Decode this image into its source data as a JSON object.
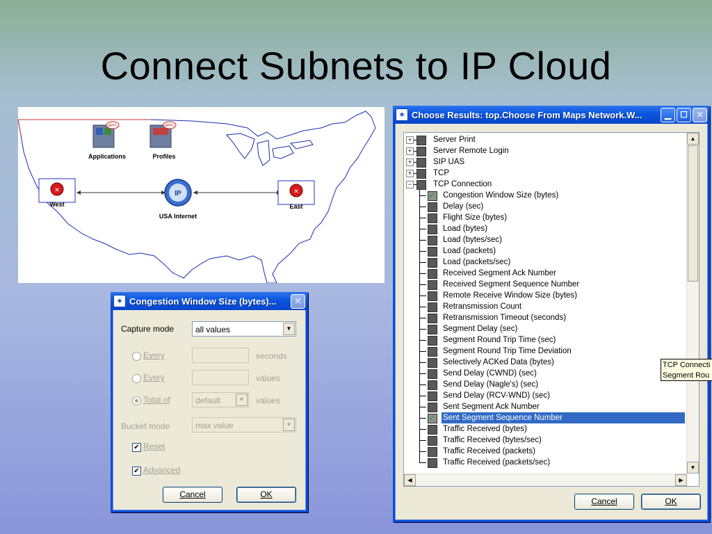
{
  "slide": {
    "title": "Connect Subnets to IP Cloud"
  },
  "map": {
    "nodes": {
      "applications": {
        "icon_text": "APPL",
        "label": "Applications"
      },
      "profiles": {
        "icon_text": "APPL",
        "label": "Profiles"
      },
      "west": {
        "label": "West"
      },
      "east": {
        "label": "East"
      },
      "internet": {
        "icon_text": "IP",
        "label": "USA Internet"
      }
    }
  },
  "congestion_dialog": {
    "title": "Congestion Window Size (bytes)...",
    "capture_mode_label": "Capture mode",
    "capture_mode_value": "all values",
    "every_seconds_label": "Every",
    "every_seconds_unit": "seconds",
    "every_values_label": "Every",
    "every_values_unit": "values",
    "total_of_label": "Total of",
    "total_of_value": "default",
    "total_of_unit": "values",
    "bucket_mode_label": "Bucket mode",
    "bucket_mode_value": "max value",
    "reset_label": "Reset",
    "advanced_label": "Advanced",
    "cancel_label": "Cancel",
    "ok_label": "OK"
  },
  "results_window": {
    "title": "Choose Results: top.Choose From Maps Network.W...",
    "items": [
      {
        "label": "Server Print",
        "level": 0,
        "expander": "+"
      },
      {
        "label": "Server Remote Login",
        "level": 0,
        "expander": "+"
      },
      {
        "label": "SIP UAS",
        "level": 0,
        "expander": "+"
      },
      {
        "label": "TCP",
        "level": 0,
        "expander": "+"
      },
      {
        "label": "TCP Connection",
        "level": 0,
        "expander": "−"
      },
      {
        "label": "Congestion Window Size (bytes)",
        "level": 1,
        "checked": true
      },
      {
        "label": "Delay (sec)",
        "level": 1
      },
      {
        "label": "Flight Size (bytes)",
        "level": 1
      },
      {
        "label": "Load (bytes)",
        "level": 1
      },
      {
        "label": "Load (bytes/sec)",
        "level": 1
      },
      {
        "label": "Load (packets)",
        "level": 1
      },
      {
        "label": "Load (packets/sec)",
        "level": 1
      },
      {
        "label": "Received Segment Ack Number",
        "level": 1
      },
      {
        "label": "Received Segment Sequence Number",
        "level": 1
      },
      {
        "label": "Remote Receive Window Size (bytes)",
        "level": 1
      },
      {
        "label": "Retransmission Count",
        "level": 1
      },
      {
        "label": "Retransmission Timeout (seconds)",
        "level": 1
      },
      {
        "label": "Segment Delay (sec)",
        "level": 1
      },
      {
        "label": "Segment Round Trip Time (sec)",
        "level": 1
      },
      {
        "label": "Segment Round Trip Time Deviation",
        "level": 1
      },
      {
        "label": "Selectively ACKed Data (bytes)",
        "level": 1
      },
      {
        "label": "Send Delay (CWND) (sec)",
        "level": 1
      },
      {
        "label": "Send Delay (Nagle's) (sec)",
        "level": 1
      },
      {
        "label": "Send Delay (RCV-WND) (sec)",
        "level": 1
      },
      {
        "label": "Sent Segment Ack Number",
        "level": 1
      },
      {
        "label": "Sent Segment Sequence Number",
        "level": 1,
        "checked": true,
        "selected": true
      },
      {
        "label": "Traffic Received (bytes)",
        "level": 1
      },
      {
        "label": "Traffic Received (bytes/sec)",
        "level": 1
      },
      {
        "label": "Traffic Received (packets)",
        "level": 1
      },
      {
        "label": "Traffic Received (packets/sec)",
        "level": 1
      }
    ],
    "cancel_label": "Cancel",
    "ok_label": "OK",
    "tooltip_line1": "TCP Connecti",
    "tooltip_line2": "Segment Rou"
  },
  "colors": {
    "title_bar": "#0b55e0",
    "selection": "#316ac5",
    "tooltip_bg": "#ffffe1",
    "node_red": "#d81a1a"
  }
}
